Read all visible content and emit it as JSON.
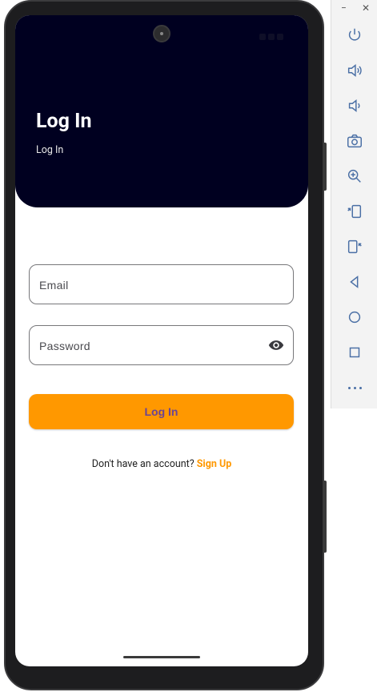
{
  "header": {
    "title": "Log In",
    "subtitle": "Log In"
  },
  "form": {
    "email_placeholder": "Email",
    "password_placeholder": "Password",
    "submit_label": "Log In"
  },
  "footer": {
    "prompt": "Don't have an account?",
    "signup_label": "Sign Up"
  },
  "colors": {
    "header_bg": "#000020",
    "accent": "#ff9800",
    "button_text": "#6a4495"
  },
  "toolbar": {
    "icons": [
      "power-icon",
      "volume-up-icon",
      "volume-down-icon",
      "camera-icon",
      "zoom-in-icon",
      "rotate-left-icon",
      "rotate-right-icon",
      "back-icon",
      "home-icon",
      "overview-icon",
      "more-icon"
    ]
  }
}
